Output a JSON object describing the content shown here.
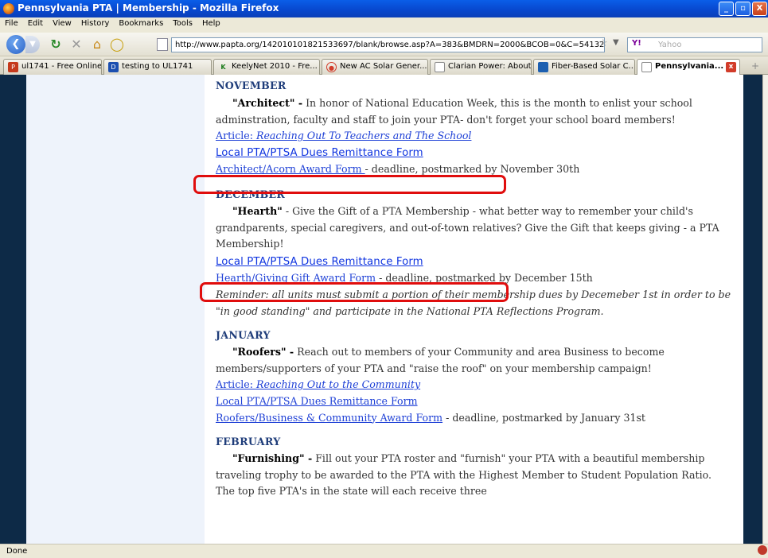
{
  "window": {
    "title": "Pennsylvania PTA | Membership - Mozilla Firefox",
    "btn_minimize": "_",
    "btn_maximize": "▫",
    "btn_close": "X"
  },
  "menu": [
    "File",
    "Edit",
    "View",
    "History",
    "Bookmarks",
    "Tools",
    "Help"
  ],
  "nav": {
    "url": "http://www.papta.org/142010101821533697/blank/browse.asp?A=383&BMDRN=2000&BCOB=0&C=54132",
    "search_placeholder": "Yahoo",
    "search_engine_label": "Y!"
  },
  "tabs": [
    {
      "label": "ul1741 - Free Online...",
      "icon": "pdf-icon"
    },
    {
      "label": "testing to UL1741",
      "icon": "d-icon"
    },
    {
      "label": "KeelyNet 2010 - Fre...",
      "icon": "kn-icon"
    },
    {
      "label": "New AC Solar Gener...",
      "icon": "circle-icon"
    },
    {
      "label": "Clarian Power: About",
      "icon": "page-icon"
    },
    {
      "label": "Fiber-Based Solar C...",
      "icon": "page-icon"
    },
    {
      "label": "Pennsylvania...",
      "icon": "page-icon",
      "active": true
    }
  ],
  "content": {
    "november": {
      "heading": "NOVEMBER",
      "theme": "\"Architect\" -",
      "text": " In honor of National Education Week, this is the month to enlist your school adminstration, faculty and staff to join your PTA- don't forget your school board members!",
      "link1_prefix": "Article: ",
      "link1_title": "Reaching Out To Teachers and The School",
      "link2": "Local PTA/PTSA Dues Remittance Form",
      "link3": "Architect/Acorn Award Form ",
      "link3_after": "- deadline, postmarked by November 30th"
    },
    "december": {
      "heading": "DECEMBER",
      "theme": "\"Hearth\"",
      "text": " - Give the Gift of a PTA Membership - what better way to remember your child's grandparents, special caregivers, and out-of-town relatives?  Give the Gift that keeps giving - a PTA Membership!",
      "link1": "Local PTA/PTSA Dues Remittance Form",
      "link2": "Hearth/Giving Gift Award Form",
      "link2_after": " - deadline, postmarked by December 15th",
      "reminder": "Reminder: all units must submit a portion of their membership dues by Decemeber 1st in order to be \"in good standing\" and participate in the National PTA Reflections Program."
    },
    "january": {
      "heading": "JANUARY",
      "theme": "\"Roofers\" -",
      "text": " Reach out to members of your Community and area Business to become members/supporters of your PTA and \"raise the roof\" on your membership campaign!",
      "link1_prefix": "Article: ",
      "link1_title": "Reaching Out to the Community",
      "link2": "Local PTA/PTSA Dues Remittance Form",
      "link3": "Roofers/Business & Community Award Form",
      "link3_after": " - deadline, postmarked by January 31st"
    },
    "february": {
      "heading": "FEBRUARY",
      "theme": "\"Furnishing\" -",
      "text": " Fill out your PTA roster and \"furnish\" your PTA with a beautiful membership traveling trophy to be awarded to the PTA with the Highest Member to Student Population Ratio.  The top five PTA's in the state will each receive three"
    }
  },
  "status": {
    "text": "Done"
  },
  "colors": {
    "highlight": "#e00d0d",
    "link": "#1d3fd6",
    "heading": "#1f3d7a",
    "sidebar": "#0d2a47"
  }
}
